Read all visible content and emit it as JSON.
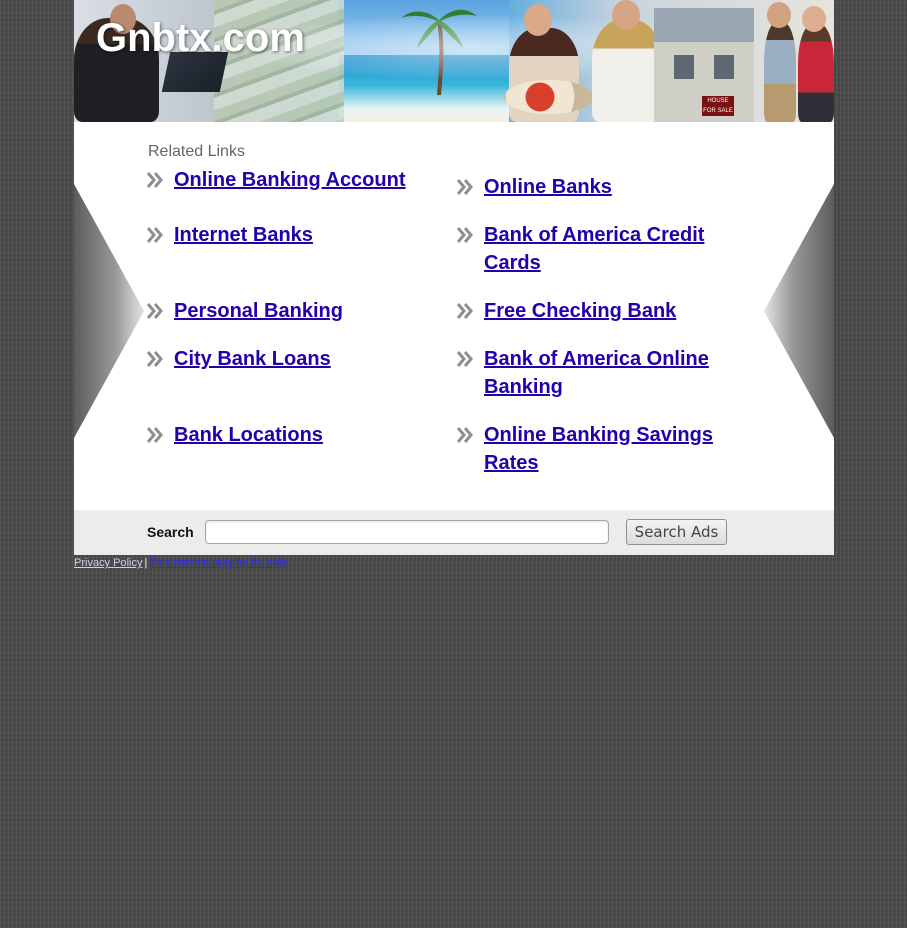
{
  "site": {
    "title": "Gnbtx.com"
  },
  "banner": {
    "sign_text": "HOUSE FOR SALE"
  },
  "related": {
    "heading": "Related Links",
    "links": [
      {
        "label": "Online Banking Account"
      },
      {
        "label": "Online Banks"
      },
      {
        "label": "Internet Banks"
      },
      {
        "label": "Bank of America Credit Cards"
      },
      {
        "label": "Personal Banking"
      },
      {
        "label": "Free Checking Bank"
      },
      {
        "label": "City Bank Loans"
      },
      {
        "label": "Bank of America Online Banking"
      },
      {
        "label": "Bank Locations"
      },
      {
        "label": "Online Banking Savings Rates"
      }
    ]
  },
  "search": {
    "label": "Search",
    "value": "",
    "button_label": "Search Ads"
  },
  "footer": {
    "privacy_label": "Privacy Policy",
    "separator": "|",
    "sale_label": "This domain may be for sale"
  },
  "icons": {
    "link_bullet": "double-chevron-right-icon",
    "side_decor": "side-arrow-decor"
  },
  "colors": {
    "link": "#2200aa",
    "background": "#4a4a4a",
    "content_bg": "#ffffff",
    "search_bar_bg": "#ececec"
  }
}
